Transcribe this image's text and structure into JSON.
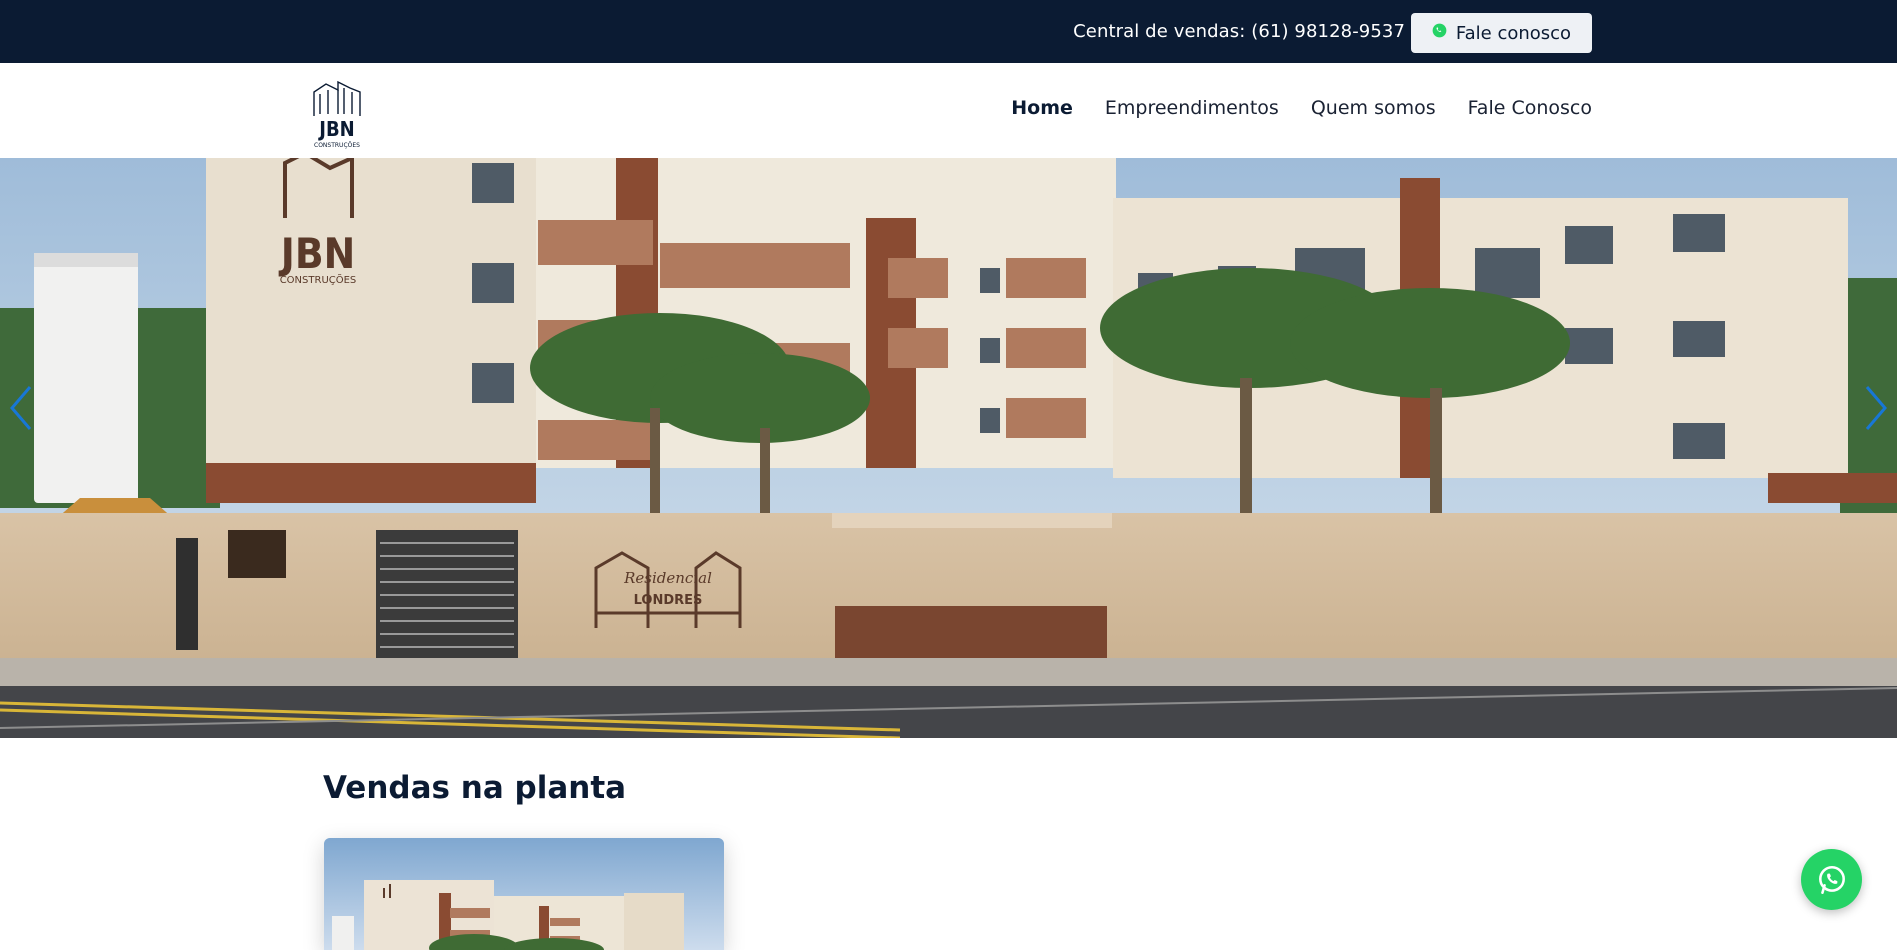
{
  "topbar": {
    "sales_text": "Central de vendas: (61) 98128-9537",
    "contact_button_label": "Fale conosco",
    "contact_icon": "whatsapp-icon"
  },
  "brand": {
    "logo_text": "JBN",
    "logo_subtext": "CONSTRUÇÕES"
  },
  "nav": {
    "items": [
      {
        "label": "Home",
        "active": true
      },
      {
        "label": "Empreendimentos",
        "active": false
      },
      {
        "label": "Quem somos",
        "active": false
      },
      {
        "label": "Fale Conosco",
        "active": false
      }
    ]
  },
  "hero": {
    "building_logo_text": "JBN",
    "building_logo_subtext": "CONSTRUÇÕES",
    "sign_line1": "Residencial",
    "sign_line2": "LONDRES",
    "prev_icon": "chevron-left-icon",
    "next_icon": "chevron-right-icon"
  },
  "section": {
    "title": "Vendas na planta"
  },
  "floating": {
    "icon": "whatsapp-icon"
  },
  "colors": {
    "topbar_bg": "#0b1b33",
    "whatsapp": "#25d366",
    "accent_brown": "#7a4630",
    "arrow_blue": "#1877d6"
  }
}
